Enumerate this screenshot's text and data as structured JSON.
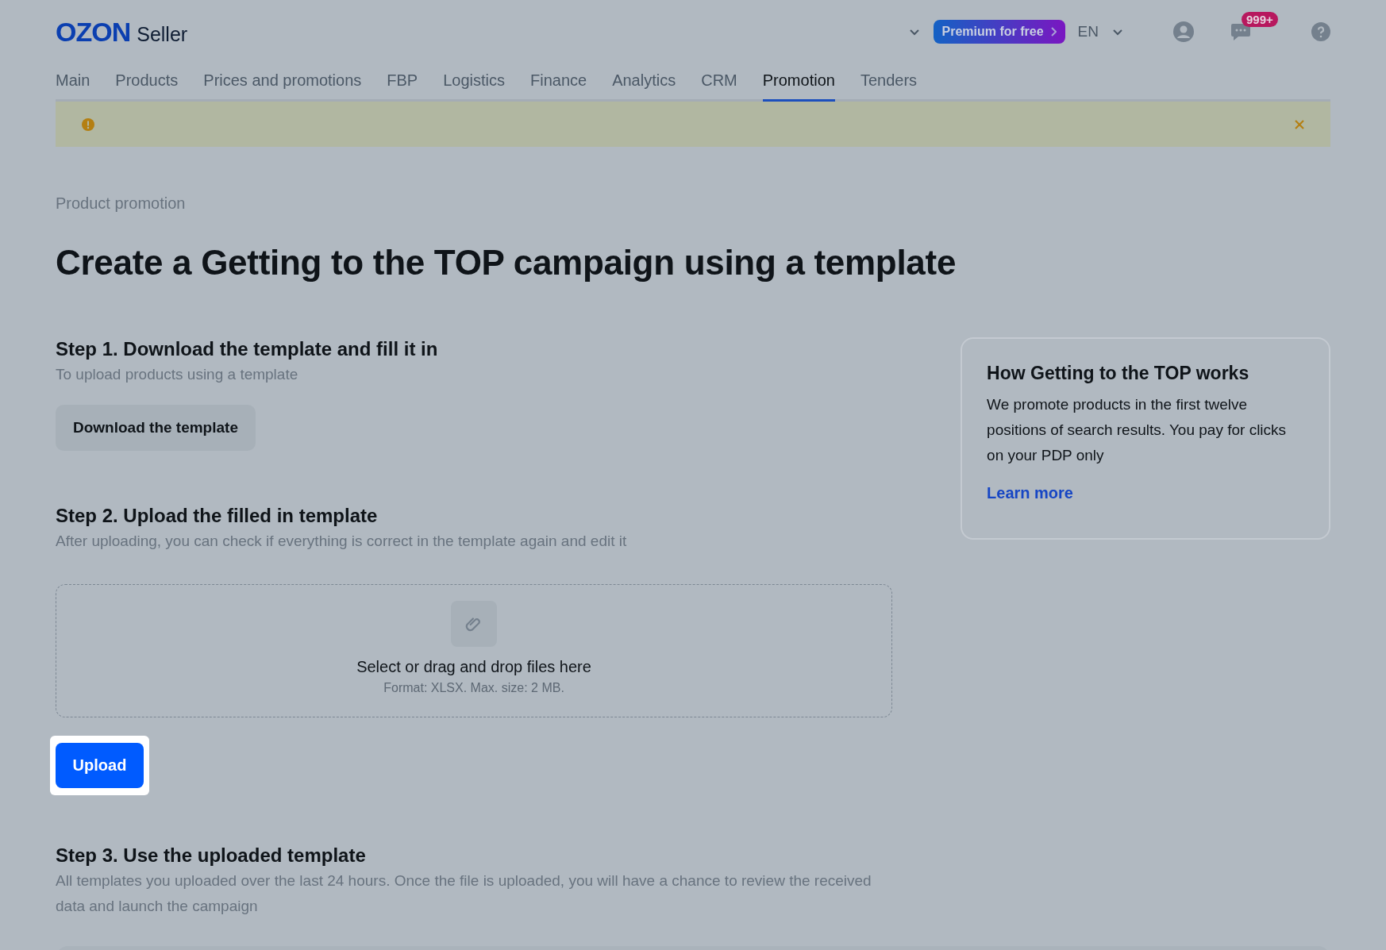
{
  "header": {
    "logo": "OZON",
    "logo_suffix": "Seller",
    "premium_button": "Premium for free",
    "language": "EN",
    "notification_count": "999+"
  },
  "tabs": [
    {
      "label": "Main",
      "selected": false
    },
    {
      "label": "Products",
      "selected": false
    },
    {
      "label": "Prices and promotions",
      "selected": false
    },
    {
      "label": "FBP",
      "selected": false
    },
    {
      "label": "Logistics",
      "selected": false
    },
    {
      "label": "Finance",
      "selected": false
    },
    {
      "label": "Analytics",
      "selected": false
    },
    {
      "label": "CRM",
      "selected": false
    },
    {
      "label": "Promotion",
      "selected": true
    },
    {
      "label": "Tenders",
      "selected": false
    }
  ],
  "breadcrumb": "Product promotion",
  "title": "Create a Getting to the TOP campaign using a template",
  "step1": {
    "heading": "Step 1. Download the template and fill it in",
    "description": "To upload products using a template",
    "button": "Download the template"
  },
  "step2": {
    "heading": "Step 2. Upload the filled in template",
    "description": "After uploading, you can check if everything is correct in the template again and edit it",
    "dropzone": {
      "text": "Select or drag and drop files here",
      "hint": "Format: XLSX. Max. size: 2 MB."
    },
    "button": "Upload"
  },
  "step3": {
    "heading": "Step 3. Use the uploaded template",
    "description": "All templates you uploaded over the last 24 hours. Once the file is uploaded, you will have a chance to review the received data and launch the campaign"
  },
  "info_card": {
    "title": "How Getting to the TOP works",
    "text": "We promote products in the first twelve positions of search results. You pay for clicks on your PDP only",
    "link": "Learn more"
  }
}
